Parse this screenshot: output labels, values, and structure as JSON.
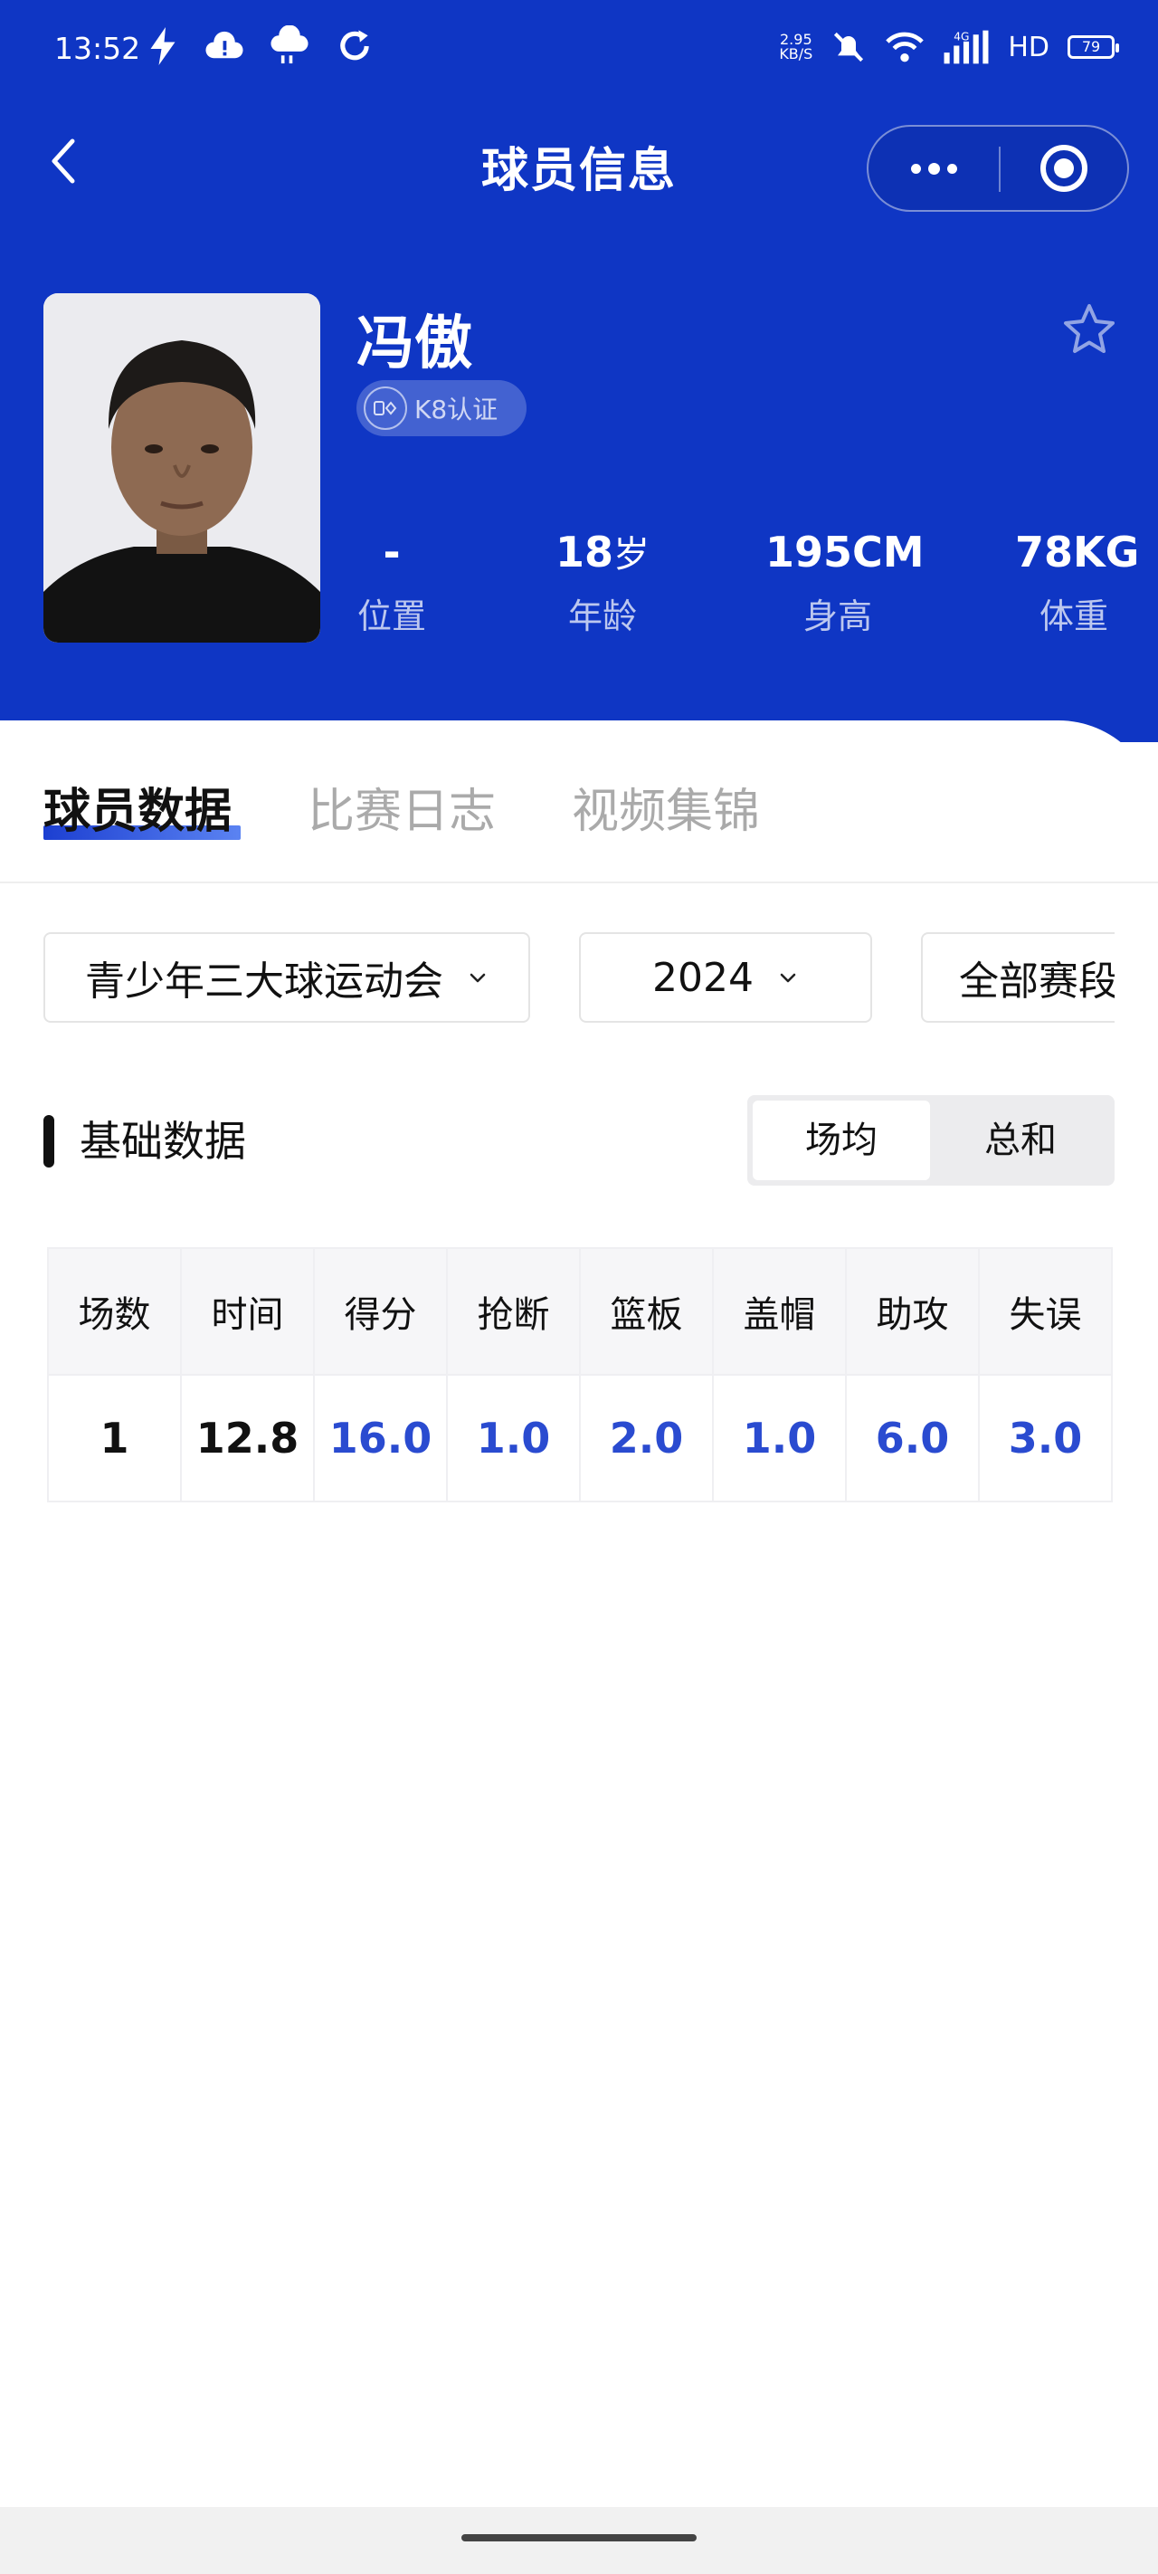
{
  "status_bar": {
    "time": "13:52",
    "speed_value": "2.95",
    "speed_unit": "KB/S",
    "network": "4G",
    "hd_label": "HD",
    "battery": "79",
    "icons": [
      "flash-icon",
      "alert-cloud-icon",
      "weather-icon",
      "sync-icon",
      "mute-icon",
      "wifi-icon",
      "signal-icon"
    ]
  },
  "nav": {
    "title": "球员信息",
    "back_icon": "back-chevron-icon",
    "more_icon": "more-dots-icon",
    "close_icon": "target-icon"
  },
  "player": {
    "name": "冯傲",
    "certification": "K8认证",
    "stats": [
      {
        "value": "-",
        "unit": "",
        "label": "位置"
      },
      {
        "value": "18",
        "unit": "岁",
        "label": "年龄"
      },
      {
        "value": "195CM",
        "unit": "",
        "label": "身高"
      },
      {
        "value": "78KG",
        "unit": "",
        "label": "体重"
      }
    ]
  },
  "tabs": [
    {
      "label": "球员数据",
      "active": true
    },
    {
      "label": "比赛日志",
      "active": false
    },
    {
      "label": "视频集锦",
      "active": false
    }
  ],
  "filters": {
    "competition": "青少年三大球运动会",
    "year": "2024",
    "stage": "全部赛段"
  },
  "section": {
    "title": "基础数据",
    "toggle": [
      "场均",
      "总和"
    ],
    "toggle_selected": "场均"
  },
  "table": {
    "headers": [
      "场数",
      "时间",
      "得分",
      "抢断",
      "篮板",
      "盖帽",
      "助攻",
      "失误"
    ],
    "row": [
      "1",
      "12.8",
      "16.0",
      "1.0",
      "2.0",
      "1.0",
      "6.0",
      "3.0"
    ]
  },
  "colors": {
    "header_blue": "#0f36c4",
    "stat_blue": "#2a4bd0"
  }
}
